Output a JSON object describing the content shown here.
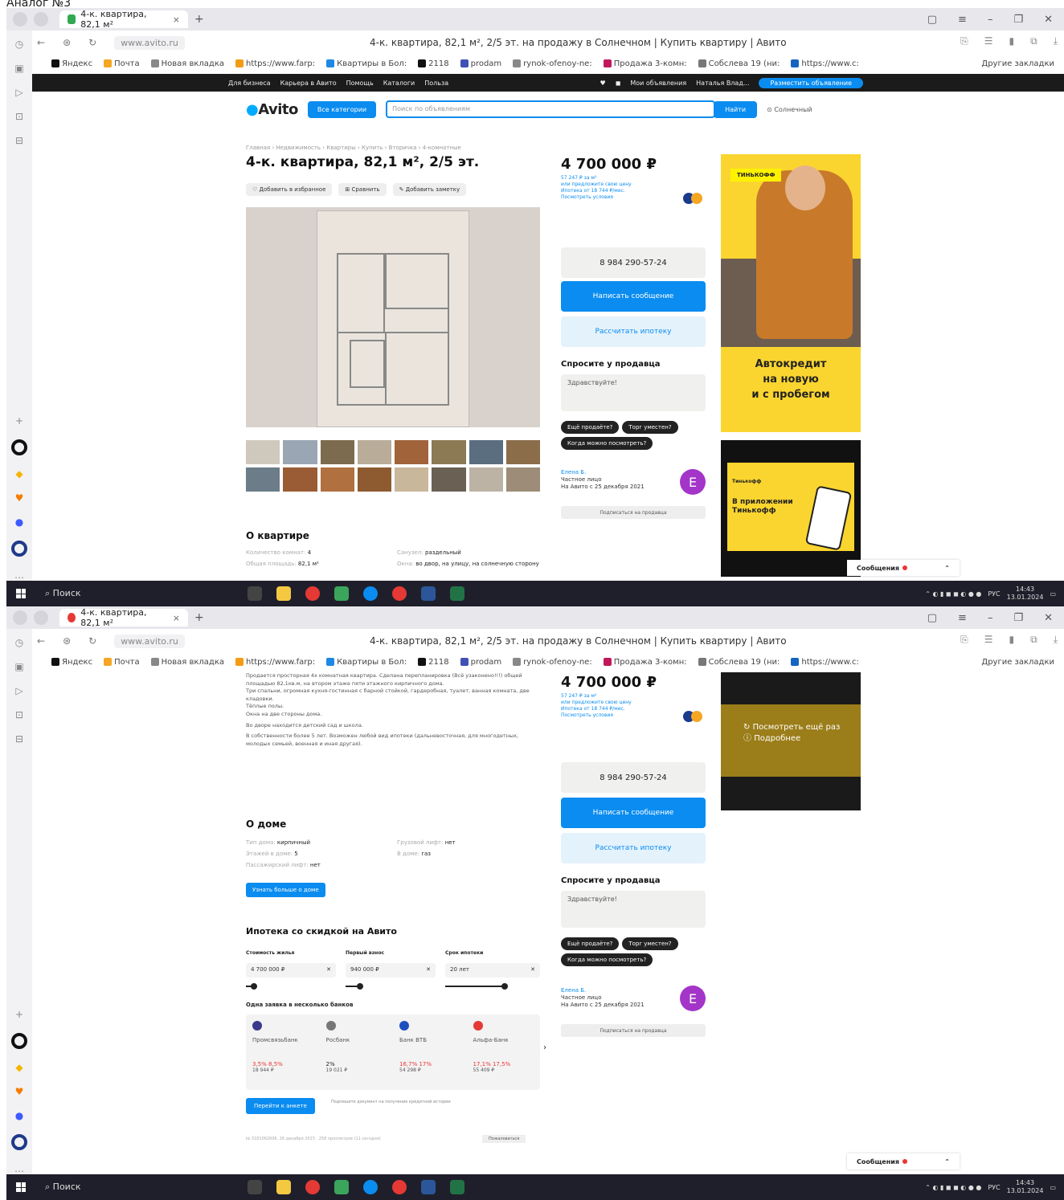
{
  "caption": "Аналог №3",
  "browser": {
    "tab_title": "4-к. квартира, 82,1 м²",
    "tab_close": "×",
    "new_tab": "+",
    "url": "www.avito.ru",
    "page_title": "4-к. квартира, 82,1 м², 2/5 эт. на продажу в Солнечном | Купить квартиру | Авито",
    "bookmarks": [
      {
        "label": "Яндекс",
        "color": "#111111"
      },
      {
        "label": "Почта",
        "color": "#f5a623"
      },
      {
        "label": "Новая вкладка",
        "color": "#888888"
      },
      {
        "label": "https://www.farp:",
        "color": "#f39c12"
      },
      {
        "label": "Квартиры в Бол:",
        "color": "#1e88e5"
      },
      {
        "label": "2118",
        "color": "#111111"
      },
      {
        "label": "prodam",
        "color": "#3f51b5"
      },
      {
        "label": "rynok-ofenoy-ne:",
        "color": "#888888"
      },
      {
        "label": "Продажа 3-комн:",
        "color": "#c2185b"
      },
      {
        "label": "Собслева 19 (ни:",
        "color": "#777777"
      },
      {
        "label": "https://www.c:",
        "color": "#1565c0"
      }
    ],
    "other_bookmarks": "Другие закладки"
  },
  "avito": {
    "black_bar_left": [
      "Для бизнеса",
      "Карьера в Авито",
      "Помощь",
      "Каталоги",
      "Польза"
    ],
    "my_ads": "Мои объявления",
    "user": "Наталья Влад...",
    "post_ad": "Разместить объявление",
    "logo": "Avito",
    "all_categories": "Все категории",
    "search_placeholder": "Поиск по объявлениям",
    "search_button": "Найти",
    "location": "Солнечный",
    "breadcrumbs": "Главная › Недвижимость › Квартиры › Купить › Вторичка › 4-комнатные",
    "title": "4-к. квартира, 82,1 м², 2/5 эт.",
    "actions": [
      "♡ Добавить в избранное",
      "⊞ Сравнить",
      "✎ Добавить заметку"
    ],
    "price": "4 700 000 ₽",
    "price_sub": [
      "57 247 ₽ за м²",
      "или предложите свою цену",
      "Ипотека от 18 744 ₽/мес.",
      "Посмотреть условия"
    ],
    "phone": "8 984 290-57-24",
    "write": "Написать сообщение",
    "mortgage": "Рассчитать ипотеку",
    "ask_title": "Спросите у продавца",
    "ask_placeholder": "Здравствуйте!",
    "chips": [
      "Ещё продаёте?",
      "Торг уместен?",
      "Когда можно посмотреть?"
    ],
    "seller_name": "Елена Б.",
    "seller_type": "Частное лицо",
    "seller_since": "На Авито с 25 декабря 2021",
    "seller_initial": "E",
    "subscribe": "Подписаться на продавца",
    "about_title": "О квартире",
    "about": [
      {
        "k": "Количество комнат:",
        "v": "4"
      },
      {
        "k": "Общая площадь:",
        "v": "82,1 м²"
      },
      {
        "k": "Санузел:",
        "v": "раздельный"
      },
      {
        "k": "Окна:",
        "v": "во двор, на улицу, на солнечную сторону"
      }
    ],
    "description": [
      "Продается просторная 4х комнатная квартира. Сделана перепланировка (Всё узаконено!!!) общей площадью 82,1кв.м, на втором этаже пяти этажного кирпичного дома.",
      "Три спальни, огромная кухня-гостинная с барной стойкой, гардеробная, туалет, ванная комната, две кладовки.",
      "Тёплые полы.",
      "Окна на две стороны дома.",
      "Во дворе находится детский сад и школа.",
      "В собственности более 5 лет. Возможен любой вид ипотеки (дальневосточная, для многодетных, молодых семьей, военная и иная другая)."
    ],
    "house_title": "О доме",
    "house": [
      {
        "k": "Тип дома:",
        "v": "кирпичный"
      },
      {
        "k": "Этажей в доме:",
        "v": "5"
      },
      {
        "k": "Пассажирский лифт:",
        "v": "нет"
      },
      {
        "k": "Грузовой лифт:",
        "v": "нет"
      },
      {
        "k": "В доме:",
        "v": "газ"
      }
    ],
    "house_more": "Узнать больше о доме",
    "mortgage_title": "Ипотека со скидкой на Авито",
    "m_fields": [
      {
        "label": "Стоимость жилья",
        "value": "4 700 000 ₽"
      },
      {
        "label": "Первый взнос",
        "value": "940 000 ₽"
      },
      {
        "label": "Срок ипотеки",
        "value": "20 лет"
      }
    ],
    "banks_title": "Одна заявка в несколько банков",
    "banks": [
      {
        "name": "Промсвязьбанк",
        "rate": "3,5% 8,5%",
        "pay": "18 944 ₽",
        "color": "#3a3a8c"
      },
      {
        "name": "Росбанк",
        "rate": "2%",
        "pay": "19 021 ₽",
        "color": "#777777"
      },
      {
        "name": "Банк ВТБ",
        "rate": "16,7% 17%",
        "pay": "54 298 ₽",
        "color": "#1e4fbf"
      },
      {
        "name": "Альфа-Банк",
        "rate": "17,1% 17,5%",
        "pay": "55 409 ₽",
        "color": "#e53935"
      }
    ],
    "goto": "Перейти к анкете",
    "goto_note": "Подпишите документ на получение кредитной истории",
    "ad_number": "№ 3181062006, 26 декабря 2023 · 258 просмотров (11 сегодня)",
    "complain": "Пожаловаться",
    "ad1_brand": "ТИНЬКОФФ",
    "ad1_text": [
      "Автокредит",
      "на новую",
      "и с пробегом"
    ],
    "ad2_brand": "Тинькофф",
    "ad2_text": [
      "В приложении",
      "Тинькофф"
    ],
    "ad3_lines": [
      "Посмотреть ещё раз",
      "Подробнее"
    ],
    "messages": "Сообщения"
  },
  "taskbar": {
    "search": "Поиск",
    "lang": "РУС",
    "time": "14:43",
    "date": "13.01.2024"
  }
}
